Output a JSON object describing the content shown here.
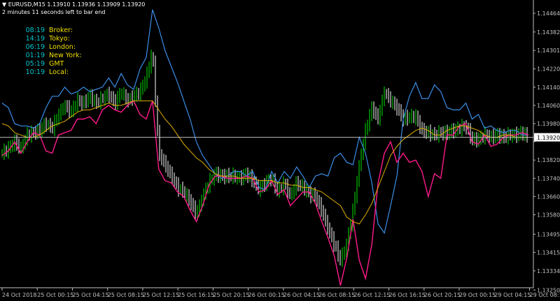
{
  "header": {
    "symbol_line": "EURUSD,M15  1.13910 1.13936 1.13909 1.13920",
    "countdown": "2 minutes 11 seconds left to bar end"
  },
  "clocks": [
    {
      "time": "08:19",
      "label": "Broker:"
    },
    {
      "time": "14:19",
      "label": "Tokyo:"
    },
    {
      "time": "06:19",
      "label": "London:"
    },
    {
      "time": "01:19",
      "label": "New York:"
    },
    {
      "time": "05:19",
      "label": "GMT"
    },
    {
      "time": "10:19",
      "label": "Local:"
    }
  ],
  "colors": {
    "background": "#000000",
    "bull_bar": "#00e400",
    "bear_bar": "#ffffff",
    "blue_line": "#3a8ee6",
    "magenta_line": "#ff1a8c",
    "orange_ma": "#e0b000",
    "clock_time": "#00c8d0",
    "clock_label": "#f2df00",
    "axis": "#c0c0c0"
  },
  "chart_data": {
    "type": "line",
    "title": "EURUSD,M15",
    "xlabel": "",
    "ylabel": "",
    "ylim": [
      1.1326,
      1.1451
    ],
    "y_ticks": [
      "1.14464",
      "1.14382",
      "1.14301",
      "1.14220",
      "1.14140",
      "1.14060",
      "1.13980",
      "1.13901",
      "1.13820",
      "1.13740",
      "1.13660",
      "1.13580",
      "1.13495",
      "1.13415",
      "1.13334",
      "1.13250"
    ],
    "x_ticks": [
      "24 Oct 2018",
      "25 Oct 00:15",
      "25 Oct 04:15",
      "25 Oct 08:15",
      "25 Oct 12:15",
      "25 Oct 16:15",
      "25 Oct 20:15",
      "26 Oct 00:15",
      "26 Oct 04:15",
      "26 Oct 08:15",
      "26 Oct 12:15",
      "26 Oct 16:15",
      "26 Oct 20:15",
      "29 Oct 00:15",
      "29 Oct 04:15",
      "29 Oct 08:15"
    ],
    "current_price": 1.1392,
    "current_price_label": "1.13920",
    "grid": false,
    "series": [
      {
        "key": "blue",
        "values": [
          1.1407,
          1.1405,
          1.1398,
          1.1397,
          1.1397,
          1.1396,
          1.1398,
          1.1405,
          1.141,
          1.141,
          1.1414,
          1.1411,
          1.1412,
          1.1414,
          1.1412,
          1.1413,
          1.1414,
          1.1418,
          1.1414,
          1.142,
          1.1415,
          1.1413,
          1.1422,
          1.1427,
          1.1448,
          1.144,
          1.143,
          1.1423,
          1.1416,
          1.1408,
          1.14,
          1.139,
          1.1384,
          1.138,
          1.1376,
          1.1374,
          1.1375,
          1.1377,
          1.1377,
          1.1375,
          1.1377,
          1.137,
          1.1369,
          1.1377,
          1.1372,
          1.1377,
          1.1374,
          1.1379,
          1.1375,
          1.137,
          1.1375,
          1.1376,
          1.1375,
          1.1383,
          1.1385,
          1.1381,
          1.138,
          1.1392,
          1.1385,
          1.1372,
          1.1354,
          1.135,
          1.1362,
          1.1375,
          1.14,
          1.141,
          1.1416,
          1.1409,
          1.1409,
          1.1415,
          1.1412,
          1.1405,
          1.1404,
          1.1404,
          1.1407,
          1.14,
          1.1402,
          1.1396,
          1.1397,
          1.1395,
          1.1394,
          1.1395,
          1.1395,
          1.1393,
          1.1393
        ]
      },
      {
        "key": "magenta",
        "values": [
          1.1384,
          1.1386,
          1.139,
          1.1385,
          1.139,
          1.1394,
          1.1393,
          1.1386,
          1.1385,
          1.1393,
          1.1394,
          1.1395,
          1.14,
          1.14,
          1.1401,
          1.1398,
          1.1404,
          1.1406,
          1.1404,
          1.1403,
          1.1406,
          1.1408,
          1.1402,
          1.14,
          1.1408,
          1.1378,
          1.1373,
          1.1372,
          1.1368,
          1.1366,
          1.136,
          1.1355,
          1.1362,
          1.1371,
          1.1375,
          1.1375,
          1.1374,
          1.1374,
          1.1374,
          1.1375,
          1.1374,
          1.1368,
          1.1369,
          1.1373,
          1.1367,
          1.1369,
          1.1362,
          1.1365,
          1.1368,
          1.1368,
          1.1363,
          1.1355,
          1.1348,
          1.134,
          1.1327,
          1.1339,
          1.1356,
          1.1338,
          1.133,
          1.1345,
          1.1372,
          1.1385,
          1.139,
          1.1381,
          1.1385,
          1.1381,
          1.1382,
          1.1377,
          1.1366,
          1.1376,
          1.1374,
          1.1393,
          1.1393,
          1.1397,
          1.1398,
          1.139,
          1.1389,
          1.1393,
          1.1388,
          1.1389,
          1.1392,
          1.1393,
          1.1393,
          1.1394,
          1.1393
        ]
      },
      {
        "key": "orange",
        "values": [
          1.1398,
          1.1397,
          1.1394,
          1.1393,
          1.1392,
          1.1392,
          1.1393,
          1.1395,
          1.1397,
          1.1398,
          1.1399,
          1.1401,
          1.1403,
          1.1404,
          1.1404,
          1.1405,
          1.1406,
          1.1407,
          1.1406,
          1.1406,
          1.1407,
          1.1408,
          1.1408,
          1.1408,
          1.1408,
          1.1404,
          1.14,
          1.1397,
          1.1393,
          1.1389,
          1.1386,
          1.1383,
          1.1381,
          1.1378,
          1.1376,
          1.1375,
          1.1375,
          1.1375,
          1.1374,
          1.1374,
          1.1374,
          1.1373,
          1.1373,
          1.1373,
          1.1372,
          1.1372,
          1.1371,
          1.1371,
          1.137,
          1.137,
          1.1369,
          1.1368,
          1.1366,
          1.1364,
          1.1362,
          1.1357,
          1.1355,
          1.1354,
          1.1358,
          1.1363,
          1.137,
          1.1377,
          1.1384,
          1.1388,
          1.1391,
          1.1393,
          1.1395,
          1.1396,
          1.1395,
          1.1393,
          1.1393,
          1.1395,
          1.1396,
          1.1397,
          1.1397,
          1.1396,
          1.1395,
          1.1393,
          1.1392,
          1.1392,
          1.1393,
          1.1393,
          1.1392,
          1.1392,
          1.1392
        ]
      },
      {
        "key": "price",
        "values": [
          1.1385,
          1.1387,
          1.139,
          1.1387,
          1.1393,
          1.1394,
          1.1395,
          1.1398,
          1.1396,
          1.1402,
          1.1406,
          1.1403,
          1.1408,
          1.1407,
          1.141,
          1.1407,
          1.1409,
          1.1411,
          1.1407,
          1.1412,
          1.1408,
          1.141,
          1.1412,
          1.1418,
          1.143,
          1.1385,
          1.138,
          1.1375,
          1.137,
          1.1368,
          1.1364,
          1.1358,
          1.1366,
          1.1372,
          1.1376,
          1.1375,
          1.1375,
          1.1375,
          1.1374,
          1.1376,
          1.1373,
          1.1369,
          1.1372,
          1.1374,
          1.1368,
          1.1372,
          1.1366,
          1.1372,
          1.137,
          1.1367,
          1.1366,
          1.136,
          1.1352,
          1.1345,
          1.1338,
          1.1345,
          1.136,
          1.138,
          1.1395,
          1.1405,
          1.14,
          1.1412,
          1.1408,
          1.1405,
          1.14,
          1.1401,
          1.1401,
          1.1395,
          1.1394,
          1.1393,
          1.1394,
          1.1394,
          1.1395,
          1.1396,
          1.1397,
          1.1391,
          1.1391,
          1.1393,
          1.1392,
          1.1393,
          1.1392,
          1.1393,
          1.1393,
          1.1394,
          1.1392
        ]
      }
    ]
  }
}
